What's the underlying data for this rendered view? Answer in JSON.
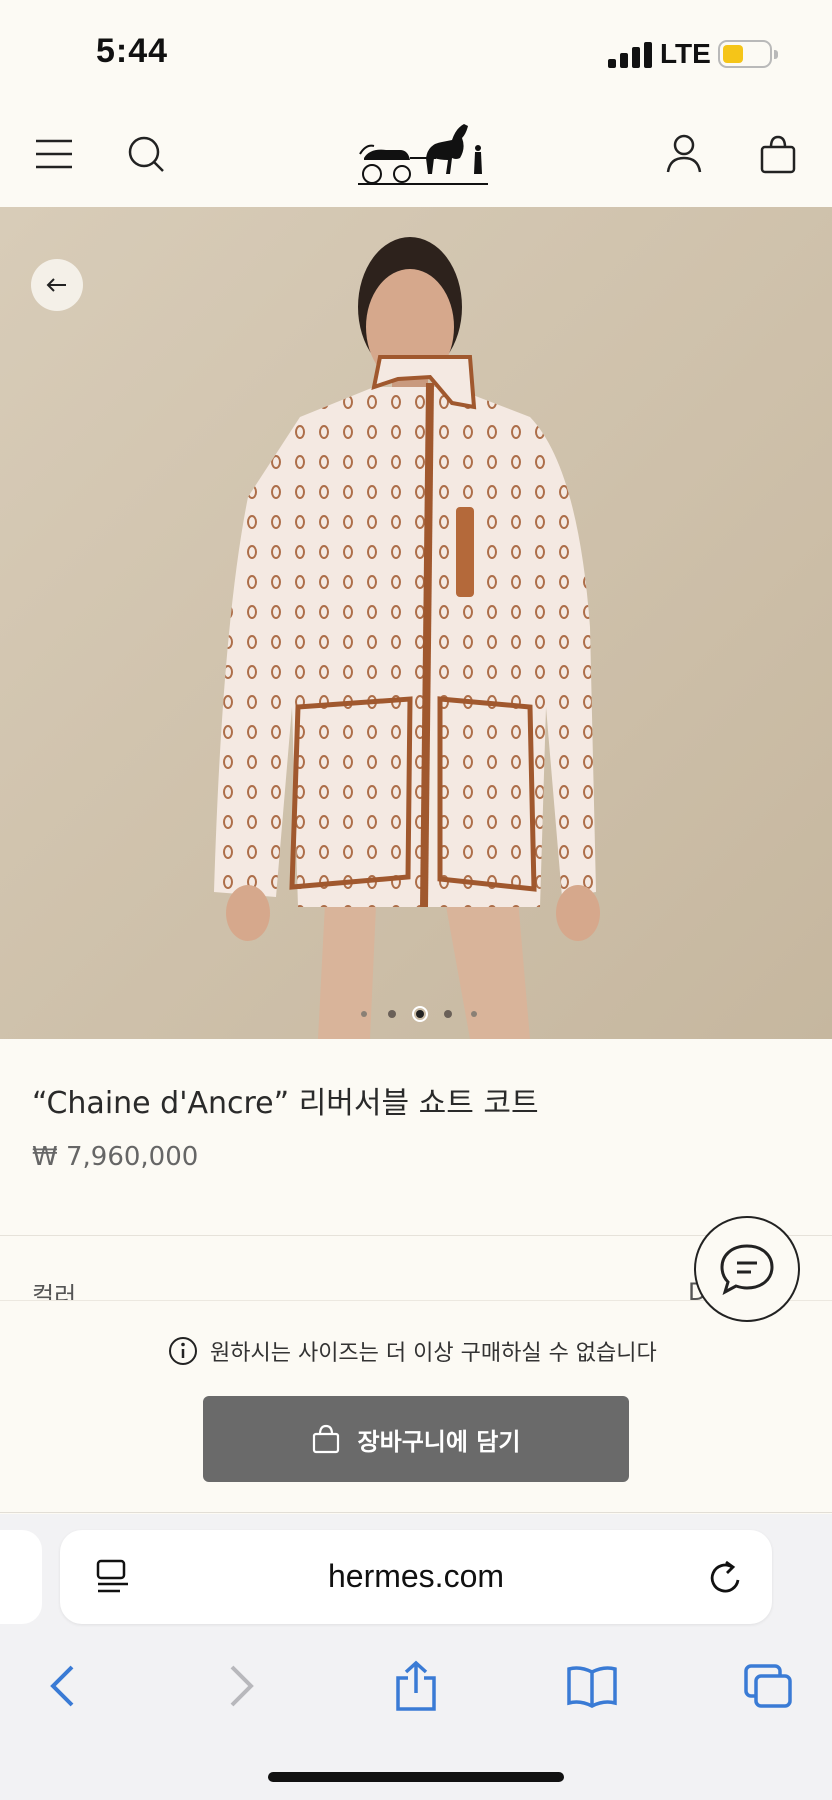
{
  "status_bar": {
    "time": "5:44",
    "network": "LTE"
  },
  "header": {
    "logo_name": "hermes-carriage-logo"
  },
  "hero": {
    "carousel_total": 5,
    "carousel_active": 3
  },
  "product": {
    "title": "“Chaine d'Ancre” 리버서블 쇼트 코트",
    "price": "₩ 7,960,000",
    "color_label": "컬러",
    "color_value": "D"
  },
  "panel": {
    "notice": "원하시는 사이즈는 더 이상 구매하실 수 없습니다",
    "cart_label": "장바구니에 담기"
  },
  "browser": {
    "url": "hermes.com"
  },
  "colors": {
    "background": "#fcfaf4",
    "hero_background": "#cfc2ad",
    "cart_button": "#6a6a6a",
    "safari_blue": "#3a7bd5",
    "battery": "#f5c518"
  }
}
